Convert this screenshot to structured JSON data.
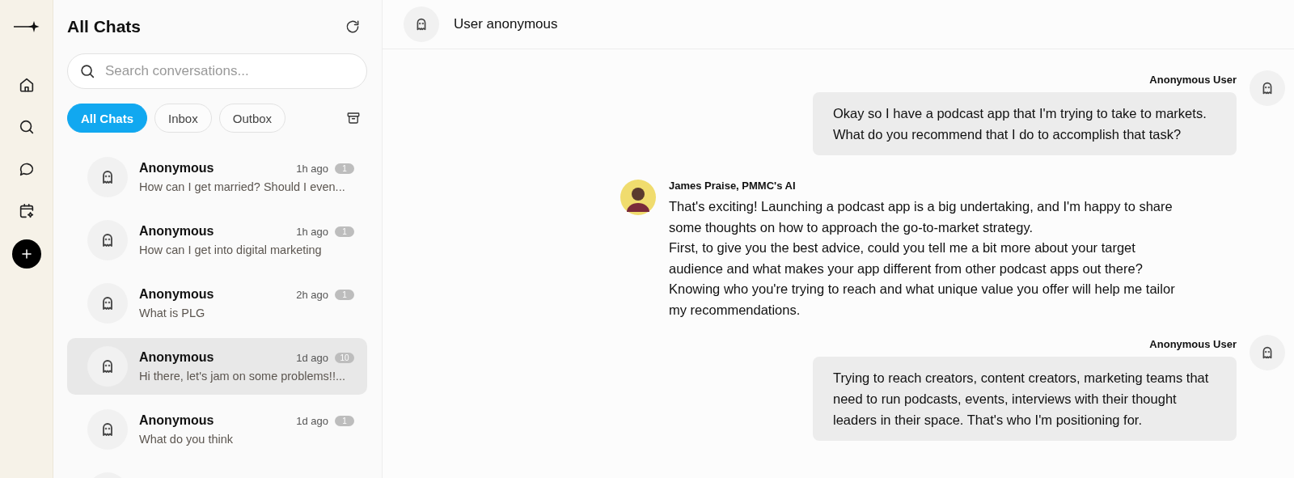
{
  "sidebar": {
    "title": "All Chats",
    "search": {
      "placeholder": "Search conversations..."
    },
    "filters": [
      {
        "label": "All Chats",
        "selected": true
      },
      {
        "label": "Inbox",
        "selected": false
      },
      {
        "label": "Outbox",
        "selected": false
      }
    ],
    "conversations": [
      {
        "name": "Anonymous",
        "time": "1h ago",
        "count": "1",
        "preview": "How can I get married? Should I even...",
        "selected": false
      },
      {
        "name": "Anonymous",
        "time": "1h ago",
        "count": "1",
        "preview": "How can I get into digital marketing",
        "selected": false
      },
      {
        "name": "Anonymous",
        "time": "2h ago",
        "count": "1",
        "preview": "What is PLG",
        "selected": false
      },
      {
        "name": "Anonymous",
        "time": "1d ago",
        "count": "10",
        "preview": "Hi there, let's jam on some problems!!...",
        "selected": true
      },
      {
        "name": "Anonymous",
        "time": "1d ago",
        "count": "1",
        "preview": "What do you think",
        "selected": false
      }
    ]
  },
  "chat": {
    "title": "User anonymous",
    "messages": [
      {
        "kind": "user",
        "author": "Anonymous User",
        "paragraphs": [
          "Okay so I have a podcast app that I'm trying to take to markets. What do you recommend that I do to accomplish that task?"
        ]
      },
      {
        "kind": "ai",
        "author": "James Praise, PMMC's AI",
        "paragraphs": [
          "That's exciting! Launching a podcast app is a big undertaking, and I'm happy to share some thoughts on how to approach the go-to-market strategy.",
          "First, to give you the best advice, could you tell me a bit more about your target audience and what makes your app different from other podcast apps out there? Knowing who you're trying to reach and what unique value you offer will help me tailor my recommendations."
        ]
      },
      {
        "kind": "user",
        "author": "Anonymous User",
        "paragraphs": [
          "Trying to reach creators, content creators, marketing teams that need to run podcasts, events, interviews with their thought leaders in their space. That's who I'm positioning for."
        ]
      }
    ]
  }
}
